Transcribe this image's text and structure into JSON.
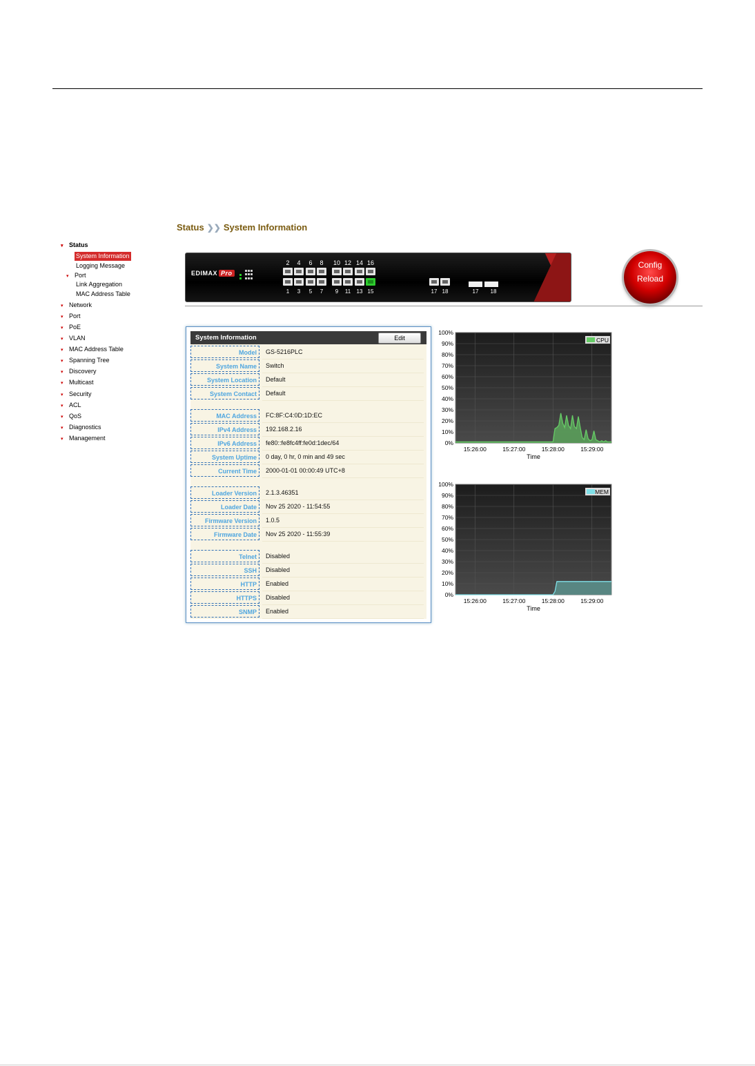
{
  "breadcrumb": {
    "section": "Status",
    "separator": "❯❯",
    "page": "System Information"
  },
  "sidebar": {
    "status": "Status",
    "status_children": [
      "System Information",
      "Logging Message"
    ],
    "port": "Port",
    "port_children": [
      "Link Aggregation",
      "MAC Address Table"
    ],
    "items": [
      "Network",
      "Port",
      "PoE",
      "VLAN",
      "MAC Address Table",
      "Spanning Tree",
      "Discovery",
      "Multicast",
      "Security",
      "ACL",
      "QoS",
      "Diagnostics",
      "Management"
    ]
  },
  "device": {
    "brand": "EDIMAX",
    "brand_suffix": "Pro",
    "top_ports": [
      "2",
      "4",
      "6",
      "8",
      "10",
      "12",
      "14",
      "16"
    ],
    "bottom_ports": [
      "1",
      "3",
      "5",
      "7",
      "9",
      "11",
      "13",
      "15"
    ],
    "link_up_port": "15",
    "copper_combo_ports": [
      "17",
      "18"
    ],
    "sfp_ports": [
      "17",
      "18"
    ]
  },
  "config_button": {
    "line1": "Config",
    "line2": "Reload"
  },
  "system_info": {
    "title": "System Information",
    "edit_label": "Edit",
    "rows": [
      {
        "label": "Model",
        "value": "GS-5216PLC"
      },
      {
        "label": "System Name",
        "value": "Switch"
      },
      {
        "label": "System Location",
        "value": "Default"
      },
      {
        "label": "System Contact",
        "value": "Default"
      },
      {
        "label": "MAC Address",
        "value": "FC:8F:C4:0D:1D:EC"
      },
      {
        "label": "IPv4 Address",
        "value": "192.168.2.16"
      },
      {
        "label": "IPv6 Address",
        "value": "fe80::fe8fc4ff:fe0d:1dec/64"
      },
      {
        "label": "System Uptime",
        "value": "0 day, 0 hr, 0 min and 49 sec"
      },
      {
        "label": "Current Time",
        "value": "2000-01-01 00:00:49 UTC+8"
      },
      {
        "label": "Loader Version",
        "value": "2.1.3.46351"
      },
      {
        "label": "Loader Date",
        "value": "Nov 25 2020 - 11:54:55"
      },
      {
        "label": "Firmware Version",
        "value": "1.0.5"
      },
      {
        "label": "Firmware Date",
        "value": "Nov 25 2020 - 11:55:39"
      },
      {
        "label": "Telnet",
        "value": "Disabled"
      },
      {
        "label": "SSH",
        "value": "Disabled"
      },
      {
        "label": "HTTP",
        "value": "Enabled"
      },
      {
        "label": "HTTPS",
        "value": "Disabled"
      },
      {
        "label": "SNMP",
        "value": "Enabled"
      }
    ]
  },
  "chart_data": [
    {
      "type": "area",
      "series_name": "CPU",
      "color": "#66cc66",
      "fill": "#5a9a5a",
      "xlabel": "Time",
      "ylabel": "",
      "yticks": [
        "0%",
        "10%",
        "20%",
        "30%",
        "40%",
        "50%",
        "60%",
        "70%",
        "80%",
        "90%",
        "100%"
      ],
      "xticks": [
        "15:26:00",
        "15:27:00",
        "15:28:00",
        "15:29:00"
      ],
      "ylim": [
        0,
        100
      ],
      "x": [
        0,
        1,
        2,
        3,
        4,
        5,
        6,
        7,
        8,
        9,
        10,
        11,
        12,
        13,
        14,
        15,
        16,
        17,
        18,
        19,
        20,
        21,
        22,
        23,
        24,
        25,
        26,
        27,
        28,
        29,
        30,
        31,
        32,
        33,
        34,
        35,
        36,
        37,
        38,
        39,
        40,
        41,
        42,
        43,
        44,
        45,
        46,
        47,
        48,
        49,
        50,
        51,
        52,
        53,
        54,
        55,
        56,
        57,
        58,
        59,
        60,
        61,
        62,
        63,
        64,
        65,
        66,
        67,
        68,
        69,
        70,
        71,
        72,
        73,
        74,
        75,
        76,
        77,
        78,
        79,
        80
      ],
      "values": [
        1,
        1,
        1,
        1,
        1,
        1,
        1,
        1,
        1,
        1,
        1,
        1,
        1,
        1,
        1,
        1,
        1,
        1,
        1,
        1,
        1,
        1,
        1,
        1,
        1,
        1,
        1,
        1,
        1,
        1,
        1,
        1,
        1,
        1,
        1,
        1,
        1,
        1,
        1,
        1,
        1,
        1,
        1,
        1,
        1,
        1,
        1,
        1,
        1,
        1,
        1,
        13,
        14,
        16,
        27,
        18,
        14,
        25,
        16,
        13,
        25,
        15,
        13,
        24,
        14,
        5,
        3,
        12,
        4,
        2,
        3,
        11,
        3,
        2,
        1,
        2,
        1,
        2,
        1,
        1,
        1
      ]
    },
    {
      "type": "area",
      "series_name": "MEM",
      "color": "#80e0e8",
      "fill": "#5a8a86",
      "xlabel": "Time",
      "ylabel": "",
      "yticks": [
        "0%",
        "10%",
        "20%",
        "30%",
        "40%",
        "50%",
        "60%",
        "70%",
        "80%",
        "90%",
        "100%"
      ],
      "xticks": [
        "15:26:00",
        "15:27:00",
        "15:28:00",
        "15:29:00"
      ],
      "ylim": [
        0,
        100
      ],
      "x": [
        0,
        1,
        2,
        3,
        4,
        5,
        6,
        7,
        8,
        9,
        10,
        11,
        12,
        13,
        14,
        15,
        16,
        17,
        18,
        19,
        20,
        21,
        22,
        23,
        24,
        25,
        26,
        27,
        28,
        29,
        30,
        31,
        32,
        33,
        34,
        35,
        36,
        37,
        38,
        39,
        40,
        41,
        42,
        43,
        44,
        45,
        46,
        47,
        48,
        49,
        50,
        51,
        52,
        53,
        54,
        55,
        56,
        57,
        58,
        59,
        60,
        61,
        62,
        63,
        64,
        65,
        66,
        67,
        68,
        69,
        70,
        71,
        72,
        73,
        74,
        75,
        76,
        77,
        78,
        79,
        80
      ],
      "values": [
        0,
        0,
        0,
        0,
        0,
        0,
        0,
        0,
        0,
        0,
        0,
        0,
        0,
        0,
        0,
        0,
        0,
        0,
        0,
        0,
        0,
        0,
        0,
        0,
        0,
        0,
        0,
        0,
        0,
        0,
        0,
        0,
        0,
        0,
        0,
        0,
        0,
        0,
        0,
        0,
        0,
        0,
        0,
        0,
        0,
        0,
        0,
        0,
        0,
        0,
        0,
        3,
        12,
        12,
        12,
        12,
        12,
        12,
        12,
        12,
        12,
        12,
        12,
        12,
        12,
        12,
        12,
        12,
        12,
        12,
        12,
        12,
        12,
        12,
        12,
        12,
        12,
        12,
        12,
        12,
        12
      ]
    }
  ]
}
